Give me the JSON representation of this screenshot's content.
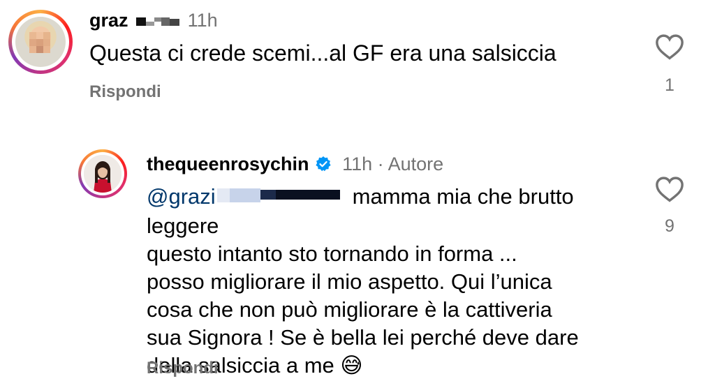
{
  "comment1": {
    "username": "graz",
    "time": "11h",
    "text": "Questa ci crede scemi...al GF era una salsiccia",
    "reply_label": "Rispondi",
    "like_count": "1"
  },
  "comment2": {
    "username": "thequeenrosychin",
    "time": "11h",
    "separator": "·",
    "author_label": "Autore",
    "mention": "@grazi",
    "line1_rest": "mamma mia che brutto leggere",
    "line2": "questo intanto sto tornando in forma ...",
    "line3": "posso migliorare il mio aspetto. Qui l’unica",
    "line4": "cosa che non può migliorare è la cattiveria",
    "line5": "sua Signora ! Se è bella lei perché deve dare",
    "line6": "della salsiccia a me",
    "emoji": "😅",
    "reply_label": "Rispondi",
    "like_count": "9"
  },
  "icons": {
    "like": "heart-icon",
    "verified": "verified-badge-icon"
  },
  "colors": {
    "secondary_text": "#737373",
    "mention": "#00376b",
    "verified": "#0095f6"
  }
}
